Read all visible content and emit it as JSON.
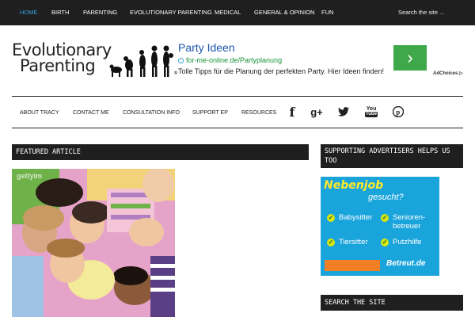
{
  "topnav": {
    "items": [
      "HOME",
      "BIRTH",
      "PARENTING",
      "EVOLUTIONARY PARENTING",
      "MEDICAL",
      "GENERAL & OPINION",
      "FUN"
    ],
    "active_index": 0,
    "search_placeholder": "Search the site ..."
  },
  "logo": {
    "line1": "Evolutionary",
    "line2": "Parenting"
  },
  "ad": {
    "title": "Party Ideen",
    "url": "for-me-online.de/Partyplanung",
    "description": "Tolle Tipps für die Planung der perfekten Party. Hier Ideen finden!",
    "button": "›",
    "adchoices": "AdChoices ▷"
  },
  "subnav": {
    "items": [
      "ABOUT TRACY",
      "CONTACT ME",
      "CONSULTATION INFO",
      "SUPPORT EP",
      "RESOURCES"
    ],
    "social": [
      {
        "name": "facebook-icon",
        "glyph": "f"
      },
      {
        "name": "google-plus-icon",
        "glyph": "g+"
      },
      {
        "name": "twitter-icon",
        "glyph": "🐦"
      },
      {
        "name": "youtube-icon",
        "glyph": "You"
      },
      {
        "name": "pinterest-icon",
        "glyph": "P"
      }
    ]
  },
  "content": {
    "featured_heading": "FEATURED ARTICLE",
    "image_watermark": "gettyim"
  },
  "sidebar": {
    "support_heading": "SUPPORTING ADVERTISERS HELPS US TOO",
    "search_heading": "SEARCH THE SITE",
    "advert": {
      "title": "Nebenjob",
      "subtitle": "gesucht?",
      "items": [
        "Babysitter",
        "Senioren-\nbetreuer",
        "Tiersitter",
        "Putzhilfe"
      ],
      "brand": "Betreut.de"
    }
  },
  "colors": {
    "nav_bg": "#1f1f1f",
    "active": "#3aa3e0",
    "ad_link": "#1a56b0",
    "ad_url": "#169435",
    "ad_button": "#3fa84a",
    "advert_bg": "#1aa4dc"
  }
}
